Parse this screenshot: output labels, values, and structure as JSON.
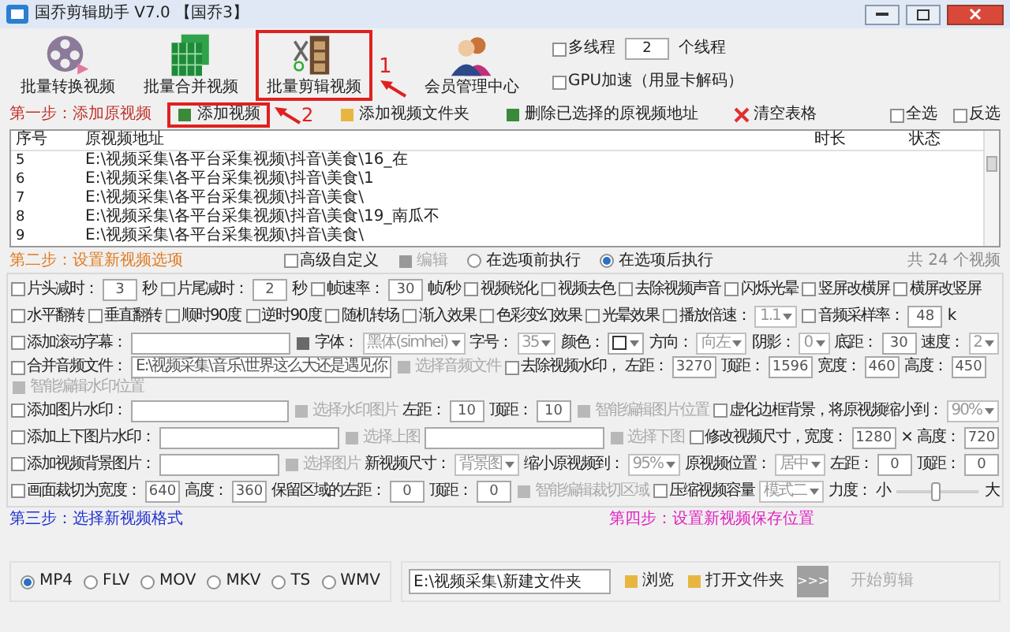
{
  "window": {
    "title": "国乔剪辑助手 V7.0 【国乔3】"
  },
  "toolbar": {
    "items": [
      {
        "kind": "convert",
        "label": "批量转换视频",
        "highlighted": false
      },
      {
        "kind": "merge",
        "label": "批量合并视频",
        "highlighted": false
      },
      {
        "kind": "cut",
        "label": "批量剪辑视频",
        "highlighted": true
      },
      {
        "kind": "members",
        "label": "会员管理中心",
        "highlighted": false
      }
    ],
    "annotation": "1",
    "multithread": {
      "label": "多线程",
      "checked": false,
      "value": "2",
      "unit": "个线程"
    },
    "gpu": {
      "label": "GPU加速（用显卡解码）",
      "checked": false
    }
  },
  "step1": {
    "title": "第一步：添加原视频",
    "annotation": "2",
    "actions": [
      {
        "kind": "add",
        "label": "添加视频",
        "highlighted": true
      },
      {
        "kind": "folder",
        "label": "添加视频文件夹",
        "highlighted": false
      },
      {
        "kind": "delete",
        "label": "删除已选择的原视频地址",
        "highlighted": false
      },
      {
        "kind": "clear",
        "label": "清空表格",
        "highlighted": false
      }
    ],
    "select_all": {
      "label": "全选",
      "checked": false
    },
    "invert": {
      "label": "反选",
      "checked": false
    }
  },
  "table": {
    "columns": [
      "序号",
      "原视频地址",
      "时长",
      "状态"
    ],
    "rows": [
      {
        "index": "5",
        "path": "E:\\视频采集\\各平台采集视频\\抖音\\美食\\16_在"
      },
      {
        "index": "6",
        "path": "E:\\视频采集\\各平台采集视频\\抖音\\美食\\1"
      },
      {
        "index": "7",
        "path": "E:\\视频采集\\各平台采集视频\\抖音\\美食\\"
      },
      {
        "index": "8",
        "path": "E:\\视频采集\\各平台采集视频\\抖音\\美食\\19_南瓜不"
      },
      {
        "index": "9",
        "path": "E:\\视频采集\\各平台采集视频\\抖音\\美食\\"
      }
    ]
  },
  "step2": {
    "title": "第二步：设置新视频选项",
    "advanced": {
      "label": "高级自定义",
      "checked": false
    },
    "edit": {
      "label": "编辑",
      "disabled": true
    },
    "timing": [
      {
        "label": "在选项前执行",
        "selected": false
      },
      {
        "label": "在选项后执行",
        "selected": true
      }
    ],
    "count": "共 24 个视频",
    "rows": [
      {
        "items": [
          {
            "kind": "checkbox",
            "label": "片头减时：",
            "checked": false
          },
          {
            "kind": "number",
            "value": "3"
          },
          {
            "kind": "text",
            "text": "秒"
          },
          {
            "kind": "checkbox",
            "label": "片尾减时：",
            "checked": false
          },
          {
            "kind": "number",
            "value": "2"
          },
          {
            "kind": "text",
            "text": "秒"
          },
          {
            "kind": "checkbox",
            "label": "帧速率：",
            "checked": false
          },
          {
            "kind": "number",
            "value": "30"
          },
          {
            "kind": "text",
            "text": "帧/秒"
          },
          {
            "kind": "checkbox",
            "label": "视频锐化",
            "checked": false
          },
          {
            "kind": "checkbox",
            "label": "视频去色",
            "checked": false
          },
          {
            "kind": "checkbox",
            "label": "去除视频声音",
            "checked": false
          },
          {
            "kind": "checkbox",
            "label": "闪烁光晕",
            "checked": false
          },
          {
            "kind": "checkbox",
            "label": "竖屏改横屏",
            "checked": false
          },
          {
            "kind": "checkbox",
            "label": "横屏改竖屏",
            "checked": false
          }
        ]
      },
      {
        "items": [
          {
            "kind": "checkbox",
            "label": "水平翻转",
            "checked": false
          },
          {
            "kind": "checkbox",
            "label": "垂直翻转",
            "checked": false
          },
          {
            "kind": "checkbox",
            "label": "顺时90度",
            "checked": false
          },
          {
            "kind": "checkbox",
            "label": "逆时90度",
            "checked": false
          },
          {
            "kind": "checkbox",
            "label": "随机转场",
            "checked": false
          },
          {
            "kind": "checkbox",
            "label": "渐入效果",
            "checked": false
          },
          {
            "kind": "checkbox",
            "label": "色彩变幻效果",
            "checked": false
          },
          {
            "kind": "checkbox",
            "label": "光晕效果",
            "checked": false
          },
          {
            "kind": "checkbox",
            "label": "播放倍速：",
            "checked": false
          },
          {
            "kind": "select",
            "value": "1.1"
          },
          {
            "kind": "checkbox",
            "label": "音频采样率：",
            "checked": false
          },
          {
            "kind": "number",
            "value": "48"
          },
          {
            "kind": "text",
            "text": "k"
          }
        ]
      },
      {
        "items": [
          {
            "kind": "checkbox",
            "label": "添加滚动字幕：",
            "checked": false
          },
          {
            "kind": "field",
            "value": ""
          },
          {
            "kind": "tool",
            "disabled": false
          },
          {
            "kind": "text",
            "text": "字体："
          },
          {
            "kind": "select",
            "value": "黑体(simhei)"
          },
          {
            "kind": "text",
            "text": "字号："
          },
          {
            "kind": "select",
            "value": "35"
          },
          {
            "kind": "text",
            "text": "颜色："
          },
          {
            "kind": "color_select"
          },
          {
            "kind": "text",
            "text": "方向："
          },
          {
            "kind": "select",
            "value": "向左"
          },
          {
            "kind": "text",
            "text": "阴影："
          },
          {
            "kind": "select",
            "value": "0"
          },
          {
            "kind": "text",
            "text": "底距："
          },
          {
            "kind": "number",
            "value": "30"
          },
          {
            "kind": "text",
            "text": "速度："
          },
          {
            "kind": "select",
            "value": "2"
          }
        ]
      },
      {
        "items": [
          {
            "kind": "checkbox",
            "label": "合并音频文件：",
            "checked": false
          },
          {
            "kind": "field",
            "value": "E:\\视频采集\\音乐\\世界这么大还是遇见你"
          },
          {
            "kind": "tool",
            "label": "选择音频文件",
            "disabled": true
          },
          {
            "kind": "checkbox",
            "label": "去除视频水印，",
            "checked": false
          },
          {
            "kind": "text",
            "text": "左距："
          },
          {
            "kind": "number",
            "value": "3270"
          },
          {
            "kind": "text",
            "text": "顶距："
          },
          {
            "kind": "number",
            "value": "1596"
          },
          {
            "kind": "text",
            "text": "宽度："
          },
          {
            "kind": "number",
            "value": "460"
          },
          {
            "kind": "text",
            "text": "高度："
          },
          {
            "kind": "number",
            "value": "450"
          },
          {
            "kind": "tool",
            "label": "智能编辑水印位置",
            "disabled": true
          }
        ]
      },
      {
        "items": [
          {
            "kind": "checkbox",
            "label": "添加图片水印：",
            "checked": false
          },
          {
            "kind": "field",
            "value": ""
          },
          {
            "kind": "tool",
            "label": "选择水印图片",
            "disabled": true
          },
          {
            "kind": "text",
            "text": "左距："
          },
          {
            "kind": "number",
            "value": "10"
          },
          {
            "kind": "text",
            "text": "顶距："
          },
          {
            "kind": "number",
            "value": "10"
          },
          {
            "kind": "tool",
            "label": "智能编辑图片位置",
            "disabled": true
          },
          {
            "kind": "checkbox",
            "label": "虚化边框背景，将原视频缩小到：",
            "checked": false
          },
          {
            "kind": "select",
            "value": "90%"
          }
        ]
      },
      {
        "items": [
          {
            "kind": "checkbox",
            "label": "添加上下图片水印：",
            "checked": false
          },
          {
            "kind": "field",
            "value": ""
          },
          {
            "kind": "tool",
            "label": "选择上图",
            "disabled": true
          },
          {
            "kind": "field",
            "value": ""
          },
          {
            "kind": "tool",
            "label": "选择下图",
            "disabled": true
          },
          {
            "kind": "checkbox",
            "label": "修改视频尺寸，宽度：",
            "checked": false
          },
          {
            "kind": "number",
            "value": "1280"
          },
          {
            "kind": "text",
            "text": "×"
          },
          {
            "kind": "text",
            "text": "高度："
          },
          {
            "kind": "number",
            "value": "720"
          }
        ]
      },
      {
        "items": [
          {
            "kind": "checkbox",
            "label": "添加视频背景图片：",
            "checked": false
          },
          {
            "kind": "field",
            "value": ""
          },
          {
            "kind": "tool",
            "label": "选择图片",
            "disabled": true
          },
          {
            "kind": "text",
            "text": "新视频尺寸："
          },
          {
            "kind": "select",
            "value": "背景图"
          },
          {
            "kind": "text",
            "text": "缩小原视频到："
          },
          {
            "kind": "select",
            "value": "95%"
          },
          {
            "kind": "text",
            "text": "原视频位置："
          },
          {
            "kind": "select",
            "value": "居中"
          },
          {
            "kind": "text",
            "text": "左距："
          },
          {
            "kind": "number",
            "value": "0"
          },
          {
            "kind": "text",
            "text": "顶距："
          },
          {
            "kind": "number",
            "value": "0"
          }
        ]
      },
      {
        "items": [
          {
            "kind": "checkbox",
            "label": "画面裁切为宽度：",
            "checked": false
          },
          {
            "kind": "number",
            "value": "640"
          },
          {
            "kind": "text",
            "text": "高度："
          },
          {
            "kind": "number",
            "value": "360"
          },
          {
            "kind": "text",
            "text": "保留区域的左距："
          },
          {
            "kind": "number",
            "value": "0"
          },
          {
            "kind": "text",
            "text": "顶距："
          },
          {
            "kind": "number",
            "value": "0"
          },
          {
            "kind": "tool",
            "label": "智能编辑裁切区域",
            "disabled": true
          },
          {
            "kind": "checkbox",
            "label": "压缩视频容量",
            "checked": false
          },
          {
            "kind": "select",
            "value": "模式二"
          },
          {
            "kind": "text",
            "text": "力度："
          },
          {
            "kind": "slider",
            "min": "小",
            "max": "大",
            "level": 0.48
          }
        ]
      }
    ]
  },
  "step3": {
    "title": "第三步：选择新视频格式",
    "formats": [
      {
        "label": "MP4",
        "selected": true
      },
      {
        "label": "FLV",
        "selected": false
      },
      {
        "label": "MOV",
        "selected": false
      },
      {
        "label": "MKV",
        "selected": false
      },
      {
        "label": "TS",
        "selected": false
      },
      {
        "label": "WMV",
        "selected": false
      }
    ]
  },
  "step4": {
    "title": "第四步：设置新视频保存位置",
    "path": "E:\\视频采集\\新建文件夹",
    "browse": "浏览",
    "open": "打开文件夹",
    "go": ">>>",
    "start": {
      "label": "开始剪辑",
      "disabled": true
    }
  }
}
